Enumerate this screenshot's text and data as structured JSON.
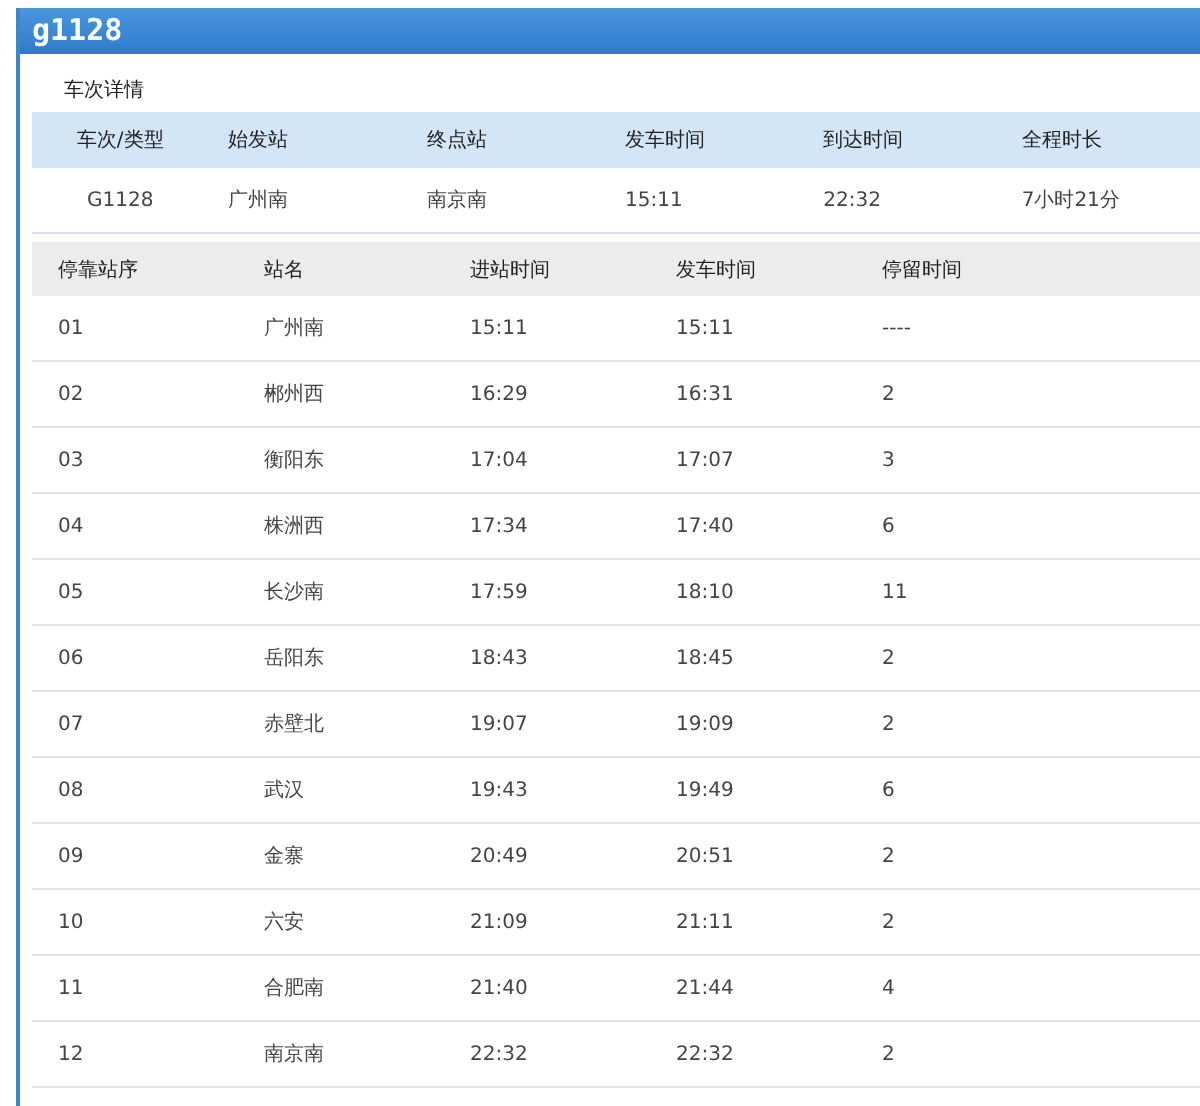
{
  "window": {
    "title": "g1128"
  },
  "section_title": "车次详情",
  "summary": {
    "columns": [
      "车次/类型",
      "始发站",
      "终点站",
      "发车时间",
      "到达时间",
      "全程时长"
    ],
    "row": [
      "G1128",
      "广州南",
      "南京南",
      "15:11",
      "22:32",
      "7小时21分"
    ]
  },
  "stops": {
    "columns": [
      "停靠站序",
      "站名",
      "进站时间",
      "发车时间",
      "停留时间"
    ],
    "rows": [
      [
        "01",
        "广州南",
        "15:11",
        "15:11",
        "----"
      ],
      [
        "02",
        "郴州西",
        "16:29",
        "16:31",
        "2"
      ],
      [
        "03",
        "衡阳东",
        "17:04",
        "17:07",
        "3"
      ],
      [
        "04",
        "株洲西",
        "17:34",
        "17:40",
        "6"
      ],
      [
        "05",
        "长沙南",
        "17:59",
        "18:10",
        "11"
      ],
      [
        "06",
        "岳阳东",
        "18:43",
        "18:45",
        "2"
      ],
      [
        "07",
        "赤壁北",
        "19:07",
        "19:09",
        "2"
      ],
      [
        "08",
        "武汉",
        "19:43",
        "19:49",
        "6"
      ],
      [
        "09",
        "金寨",
        "20:49",
        "20:51",
        "2"
      ],
      [
        "10",
        "六安",
        "21:09",
        "21:11",
        "2"
      ],
      [
        "11",
        "合肥南",
        "21:40",
        "21:44",
        "4"
      ],
      [
        "12",
        "南京南",
        "22:32",
        "22:32",
        "2"
      ]
    ]
  }
}
